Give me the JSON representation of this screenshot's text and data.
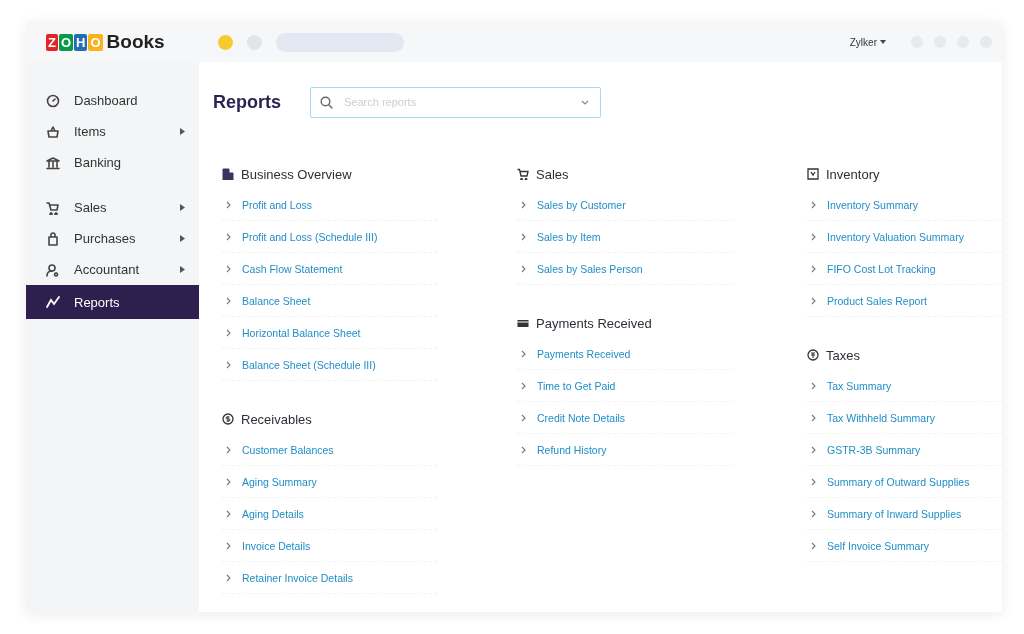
{
  "app": {
    "logo_letters": [
      {
        "letter": "Z",
        "color": "#e42527"
      },
      {
        "letter": "O",
        "color": "#089949"
      },
      {
        "letter": "H",
        "color": "#226db4"
      },
      {
        "letter": "O",
        "color": "#f9b21d"
      }
    ],
    "product": "Books"
  },
  "top_bar": {
    "organization": "Zylker"
  },
  "sidebar": {
    "groups": [
      [
        {
          "label": "Dashboard",
          "has_submenu": false,
          "selected": false
        },
        {
          "label": "Items",
          "has_submenu": true,
          "selected": false
        },
        {
          "label": "Banking",
          "has_submenu": false,
          "selected": false
        }
      ],
      [
        {
          "label": "Sales",
          "has_submenu": true,
          "selected": false
        },
        {
          "label": "Purchases",
          "has_submenu": true,
          "selected": false
        },
        {
          "label": "Accountant",
          "has_submenu": true,
          "selected": false
        },
        {
          "label": "Reports",
          "has_submenu": false,
          "selected": true
        }
      ]
    ]
  },
  "page": {
    "title": "Reports",
    "search": {
      "placeholder": "Search reports"
    }
  },
  "columns": [
    {
      "sections": [
        {
          "title": "Business Overview",
          "reports": [
            "Profit and Loss",
            "Profit and Loss (Schedule III)",
            "Cash Flow Statement",
            "Balance Sheet",
            "Horizontal Balance Sheet",
            "Balance Sheet (Schedule III)"
          ]
        },
        {
          "title": "Receivables",
          "reports": [
            "Customer Balances",
            "Aging Summary",
            "Aging Details",
            "Invoice Details",
            "Retainer Invoice Details"
          ]
        }
      ]
    },
    {
      "sections": [
        {
          "title": "Sales",
          "reports": [
            "Sales by Customer",
            "Sales by Item",
            "Sales by Sales Person"
          ]
        },
        {
          "title": "Payments Received",
          "reports": [
            "Payments Received",
            "Time to Get Paid",
            "Credit Note Details",
            "Refund History"
          ]
        }
      ]
    },
    {
      "sections": [
        {
          "title": "Inventory",
          "reports": [
            "Inventory Summary",
            "Inventory Valuation Summary",
            "FIFO Cost Lot Tracking",
            "Product Sales Report"
          ]
        },
        {
          "title": "Taxes",
          "reports": [
            "Tax Summary",
            "Tax Withheld Summary",
            "GSTR-3B Summary",
            "Summary of Outward Supplies",
            "Summary of Inward Supplies",
            "Self Invoice Summary"
          ]
        }
      ]
    }
  ]
}
